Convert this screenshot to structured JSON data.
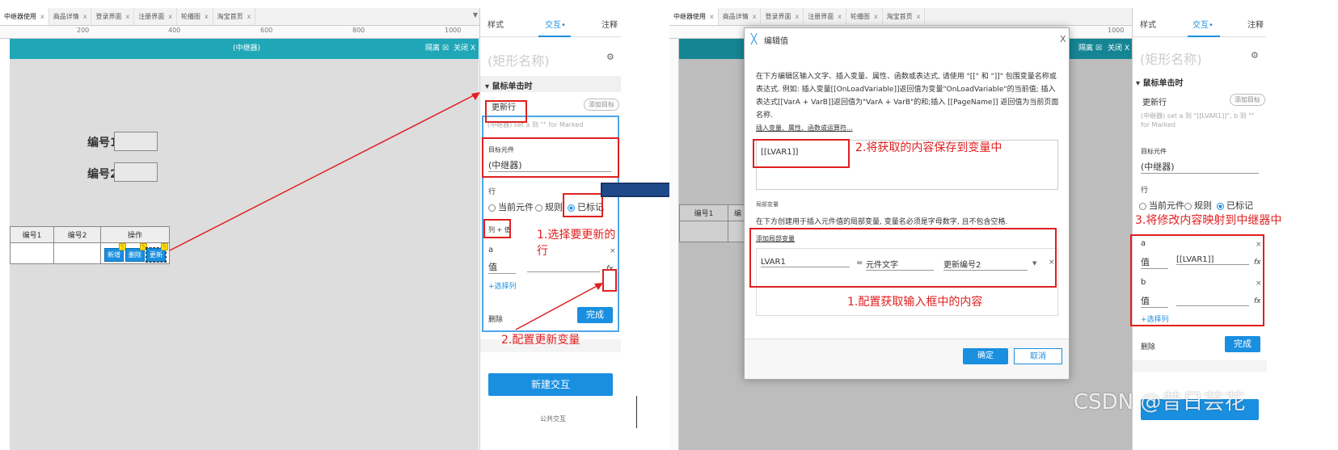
{
  "left": {
    "tabs": [
      "中继器使用",
      "商品详情",
      "登录界面",
      "注册界面",
      "轮播图",
      "淘宝首页"
    ],
    "tab_close": "x",
    "ruler": [
      "200",
      "400",
      "600",
      "800",
      "1000"
    ],
    "repeater_title": "(中继器)",
    "isolate_label": "隔离 ☒",
    "close_label": "关闭 X",
    "field1_label": "编号1",
    "field2_label": "编号2",
    "table_headers": [
      "编号1",
      "编号2",
      "操作"
    ],
    "row_buttons": [
      "新增",
      "删除",
      "更新"
    ]
  },
  "left_side": {
    "tabs": [
      "样式",
      "交互•",
      "注释"
    ],
    "shape_name": "(矩形名称)",
    "event_title": "▾ 鼠标单击时",
    "action_name": "更新行",
    "add_target": "添加目标",
    "action_desc": "(中继器) set a 到 \"\" for Marked",
    "target_label": "目标元件",
    "target_value": "(中继器)",
    "row_label": "行",
    "radio_options": [
      "当前元件",
      "规则",
      "已标记"
    ],
    "col_value_label": "列 + 值",
    "col_a": "a",
    "value_label": "值",
    "fx": "fx",
    "add_column": "+选择列",
    "delete_label": "删除",
    "done_label": "完成",
    "new_interaction": "新建交互",
    "public_interaction": "公共交互"
  },
  "annotations_left": {
    "step1": "1.选择要更新的行",
    "step2": "2.配置更新变量"
  },
  "right": {
    "tabs": [
      "中继器使用",
      "商品详情",
      "登录界面",
      "注册界面",
      "轮播图",
      "淘宝首页"
    ],
    "table_headers": [
      "编号1",
      "编"
    ],
    "ruler": [
      "1000"
    ],
    "isolate_label": "隔离 ☒",
    "close_label": "关闭 X"
  },
  "dialog": {
    "title": "编辑值",
    "close": "X",
    "description": "在下方编辑区输入文字、插入变量、属性、函数或表达式, 请使用 \"[[\" 和 \"]]\" 包围变量名称或表达式. 例如: 插入变量[[OnLoadVariable]]返回值为变量\"OnLoadVariable\"的当前值; 插入表达式[[VarA + VarB]]返回值为\"VarA + VarB\"的和;插入 [[PageName]] 返回值为当前页面名称.",
    "insert_link": "插入变量、属性、函数或运算符...",
    "editor_value": "[[LVAR1]]",
    "local_vars_title": "局部变量",
    "local_vars_desc": "在下方创建用于插入元件值的局部变量, 变量名必须是字母数字, 且不包含空格.",
    "add_local_var": "添加局部变量",
    "var_name": "LVAR1",
    "equals": "=",
    "var_type": "元件文字",
    "var_target": "更新编号2",
    "ok": "确定",
    "cancel": "取消"
  },
  "annotations_right": {
    "step1": "1.配置获取输入框中的内容",
    "step2": "2.将获取的内容保存到变量中",
    "step3": "3.将修改内容映射到中继器中"
  },
  "right_side": {
    "tabs": [
      "样式",
      "交互•",
      "注释"
    ],
    "shape_name": "(矩形名称)",
    "event_title": "▾ 鼠标单击时",
    "action_name": "更新行",
    "add_target": "添加目标",
    "action_desc": "(中继器) set a 到 \"[[LVAR1]]\", b 到 \"\" for Marked",
    "target_label": "目标元件",
    "target_value": "(中继器)",
    "row_label": "行",
    "radio_options": [
      "当前元件",
      "规则",
      "已标记"
    ],
    "col_a": "a",
    "col_b": "b",
    "value_label": "值",
    "value_a": "[[LVAR1]]",
    "fx": "fx",
    "add_column": "+选择列",
    "delete_label": "删除",
    "done_label": "完成"
  },
  "watermark": "CSDN @昔日芸花"
}
